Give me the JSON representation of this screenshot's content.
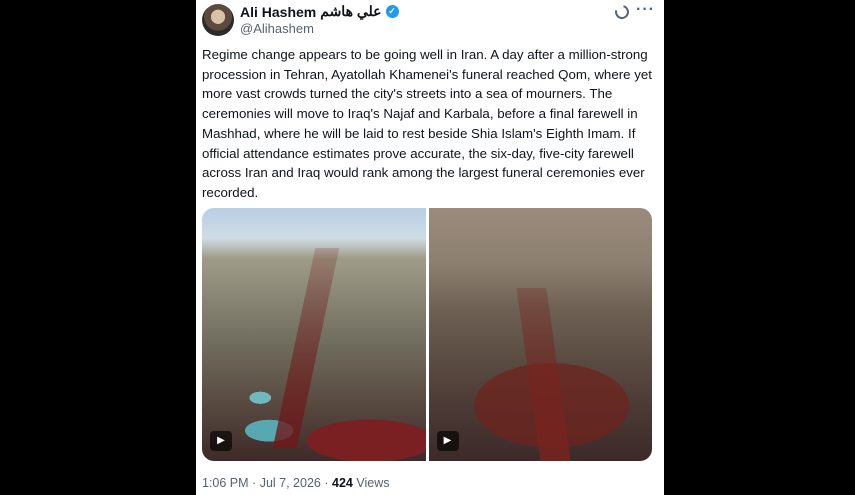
{
  "tweet": {
    "display_name": "Ali Hashem",
    "arabic_name": "علي هاشم",
    "handle": "@Alihashem",
    "text": "Regime change appears to be going well in Iran. A day after a million-strong procession in Tehran, Ayatollah Khamenei's funeral reached Qom, where yet more vast crowds turned the city's streets into a sea of mourners. The ceremonies will move to Iraq's Najaf and Karbala, before a final farewell in Mashhad, where he will be laid to rest beside Shia Islam's Eighth Imam. If official attendance estimates prove accurate, the six-day, five-city farewell across Iran and Iraq would rank among the largest funeral ceremonies ever recorded.",
    "time": "1:06 PM",
    "date": "Jul 7, 2026",
    "views_count": "424",
    "views_label": "Views",
    "separator": "·"
  },
  "icons": {
    "verified": "verified-badge-icon",
    "grok": "grok-icon",
    "more": "more-icon",
    "play": "play-icon"
  },
  "colors": {
    "verified": "#1d9bf0",
    "secondary_text": "#536471",
    "primary_text": "#0f1419"
  }
}
